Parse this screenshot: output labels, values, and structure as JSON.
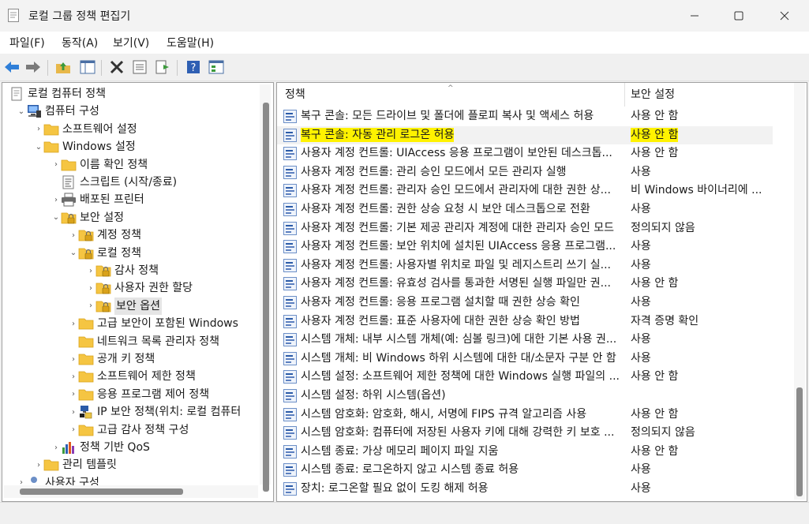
{
  "window": {
    "title": "로컬 그룹 정책 편집기"
  },
  "menu": [
    "파일(F)",
    "동작(A)",
    "보기(V)",
    "도움말(H)"
  ],
  "toolbar": [
    "back-icon",
    "forward-icon",
    "up-folder-icon",
    "show-tree-icon",
    "delete-icon",
    "properties-icon",
    "export-icon",
    "help-icon",
    "view-icon"
  ],
  "tree": [
    {
      "label": "로컬 컴퓨터 정책",
      "level": 0,
      "expander": "",
      "icon": "policy-doc-icon"
    },
    {
      "label": "컴퓨터 구성",
      "level": 1,
      "expander": "open",
      "icon": "computer-icon"
    },
    {
      "label": "소프트웨어 설정",
      "level": 2,
      "expander": "closed",
      "icon": "folder-icon"
    },
    {
      "label": "Windows 설정",
      "level": 2,
      "expander": "open",
      "icon": "folder-icon"
    },
    {
      "label": "이름 확인 정책",
      "level": 3,
      "expander": "closed",
      "icon": "folder-icon"
    },
    {
      "label": "스크립트 (시작/종료)",
      "level": 3,
      "expander": "",
      "icon": "script-icon"
    },
    {
      "label": "배포된 프린터",
      "level": 3,
      "expander": "closed",
      "icon": "printer-icon"
    },
    {
      "label": "보안 설정",
      "level": 3,
      "expander": "open",
      "icon": "security-folder-icon"
    },
    {
      "label": "계정 정책",
      "level": 4,
      "expander": "closed",
      "icon": "security-folder-icon"
    },
    {
      "label": "로컬 정책",
      "level": 4,
      "expander": "open",
      "icon": "security-folder-icon"
    },
    {
      "label": "감사 정책",
      "level": 5,
      "expander": "closed",
      "icon": "security-folder-icon"
    },
    {
      "label": "사용자 권한 할당",
      "level": 5,
      "expander": "closed",
      "icon": "security-folder-icon"
    },
    {
      "label": "보안 옵션",
      "level": 5,
      "expander": "closed",
      "icon": "security-folder-icon",
      "selected": true
    },
    {
      "label": "고급 보안이 포함된 Windows",
      "level": 4,
      "expander": "closed",
      "icon": "folder-icon"
    },
    {
      "label": "네트워크 목록 관리자 정책",
      "level": 4,
      "expander": "",
      "icon": "folder-icon"
    },
    {
      "label": "공개 키 정책",
      "level": 4,
      "expander": "closed",
      "icon": "folder-icon"
    },
    {
      "label": "소프트웨어 제한 정책",
      "level": 4,
      "expander": "closed",
      "icon": "folder-icon"
    },
    {
      "label": "응용 프로그램 제어 정책",
      "level": 4,
      "expander": "closed",
      "icon": "folder-icon"
    },
    {
      "label": "IP 보안 정책(위치: 로컬 컴퓨터",
      "level": 4,
      "expander": "closed",
      "icon": "ip-security-icon"
    },
    {
      "label": "고급 감사 정책 구성",
      "level": 4,
      "expander": "closed",
      "icon": "folder-icon"
    },
    {
      "label": "정책 기반 QoS",
      "level": 3,
      "expander": "closed",
      "icon": "qos-chart-icon"
    },
    {
      "label": "관리 템플릿",
      "level": 2,
      "expander": "closed",
      "icon": "folder-icon"
    },
    {
      "label": "사용자 구성",
      "level": 1,
      "expander": "closed",
      "icon": "user-icon"
    }
  ],
  "list": {
    "columns": [
      "정책",
      "보안 설정"
    ],
    "rows": [
      {
        "policy": "복구 콘솔: 모든 드라이브 및 폴더에 플로피 복사 및 액세스 허용",
        "setting": "사용 안 함"
      },
      {
        "policy": "복구 콘솔: 자동 관리 로그온 허용",
        "setting": "사용 안 함",
        "selected": true
      },
      {
        "policy": "사용자 계정 컨트롤: UIAccess 응용 프로그램이 보안된 데스크톱을 사용하지 않고 권한 상승을 요청하도록 허용",
        "setting": "사용 안 함"
      },
      {
        "policy": "사용자 계정 컨트롤: 관리 승인 모드에서 모든 관리자 실행",
        "setting": "사용"
      },
      {
        "policy": "사용자 계정 컨트롤: 관리자 승인 모드에서 관리자에 대한 권한 상승 확인 방법",
        "setting": "비 Windows 바이너리에 대해 동의 확인"
      },
      {
        "policy": "사용자 계정 컨트롤: 권한 상승 요청 시 보안 데스크톱으로 전환",
        "setting": "사용"
      },
      {
        "policy": "사용자 계정 컨트롤: 기본 제공 관리자 계정에 대한 관리자 승인 모드",
        "setting": "정의되지 않음"
      },
      {
        "policy": "사용자 계정 컨트롤: 보안 위치에 설치된 UIAccess 응용 프로그램만 권한 상승",
        "setting": "사용"
      },
      {
        "policy": "사용자 계정 컨트롤: 사용자별 위치로 파일 및 레지스트리 쓰기 실패 가상화",
        "setting": "사용"
      },
      {
        "policy": "사용자 계정 컨트롤: 유효성 검사를 통과한 서명된 실행 파일만 권한 상승",
        "setting": "사용 안 함"
      },
      {
        "policy": "사용자 계정 컨트롤: 응용 프로그램 설치할 때 권한 상승 확인",
        "setting": "사용"
      },
      {
        "policy": "사용자 계정 컨트롤: 표준 사용자에 대한 권한 상승 확인 방법",
        "setting": "자격 증명 확인"
      },
      {
        "policy": "시스템 개체: 내부 시스템 개체(예: 심볼 링크)에 대한 기본 사용 권한 강화",
        "setting": "사용"
      },
      {
        "policy": "시스템 개체: 비 Windows 하위 시스템에 대한 대/소문자 구분 안 함",
        "setting": "사용"
      },
      {
        "policy": "시스템 설정: 소프트웨어 제한 정책에 대한 Windows 실행 파일의 인증서 규칙 사용",
        "setting": "사용 안 함"
      },
      {
        "policy": "시스템 설정: 하위 시스템(옵션)",
        "setting": ""
      },
      {
        "policy": "시스템 암호화: 암호화, 해시, 서명에 FIPS 규격 알고리즘 사용",
        "setting": "사용 안 함"
      },
      {
        "policy": "시스템 암호화: 컴퓨터에 저장된 사용자 키에 대해 강력한 키 보호 사용",
        "setting": "정의되지 않음"
      },
      {
        "policy": "시스템 종료: 가상 메모리 페이지 파일 지움",
        "setting": "사용 안 함"
      },
      {
        "policy": "시스템 종료: 로그온하지 않고 시스템 종료 허용",
        "setting": "사용"
      },
      {
        "policy": "장치: 로그온할 필요 없이 도킹 해제 허용",
        "setting": "사용"
      }
    ]
  },
  "colors": {
    "selection_highlight": "#fff200",
    "folder": "#f5c542"
  }
}
